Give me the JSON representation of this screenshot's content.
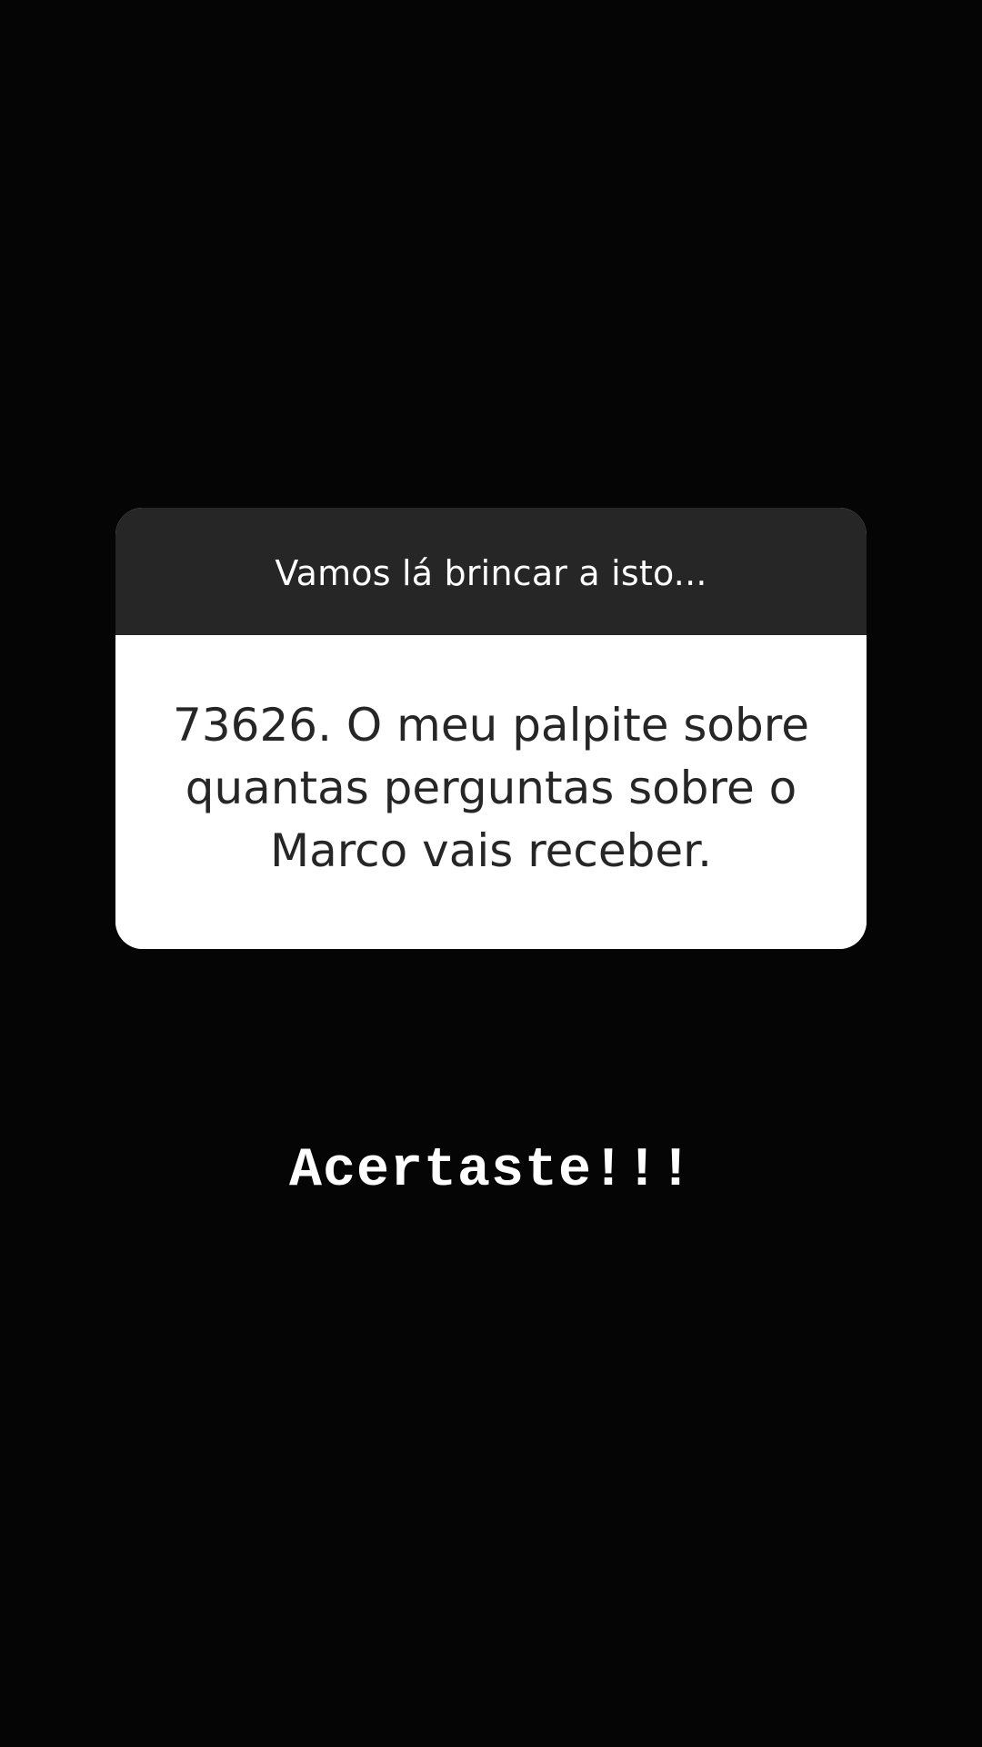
{
  "story": {
    "background_color": "#050505"
  },
  "question_card": {
    "prompt": "Vamos lá brincar a isto...",
    "answer": "73626. O meu palpite sobre quantas perguntas sobre o Marco vais receber.",
    "header_color": "#262626",
    "body_color": "#ffffff",
    "answer_text_color": "#262626"
  },
  "reply": {
    "text": "Acertaste!!!",
    "color": "#ffffff"
  }
}
